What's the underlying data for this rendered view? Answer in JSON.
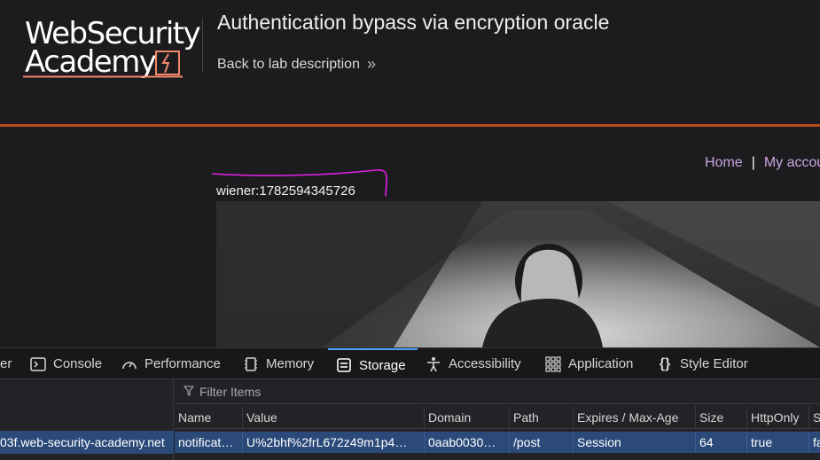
{
  "header": {
    "logo_line1": "WebSecurity",
    "logo_line2": "Academy",
    "lab_title": "Authentication bypass via encryption oracle",
    "back_link": "Back to lab description",
    "back_chevron": "»"
  },
  "nav": {
    "home": "Home",
    "separator": "|",
    "my_account": "My accou"
  },
  "content": {
    "user_identifier": "wiener:1782594345726"
  },
  "devtools": {
    "tabs": [
      {
        "label": "er",
        "icon": "inspector-icon"
      },
      {
        "label": "Console",
        "icon": "console-icon"
      },
      {
        "label": "Performance",
        "icon": "performance-icon"
      },
      {
        "label": "Memory",
        "icon": "memory-icon"
      },
      {
        "label": "Storage",
        "icon": "storage-icon",
        "active": true
      },
      {
        "label": "Accessibility",
        "icon": "accessibility-icon"
      },
      {
        "label": "Application",
        "icon": "application-icon"
      },
      {
        "label": "Style Editor",
        "icon": "style-editor-icon"
      }
    ],
    "tree_selected": "03f.web-security-academy.net",
    "filter_placeholder": "Filter Items",
    "columns": [
      "Name",
      "Value",
      "Domain",
      "Path",
      "Expires / Max-Age",
      "Size",
      "HttpOnly",
      "S"
    ],
    "rows": [
      [
        "notificat…",
        "U%2bhf%2frL672z49m1p4…",
        "0aab0030…",
        "/post",
        "Session",
        "64",
        "true",
        "fa"
      ]
    ]
  },
  "colors": {
    "accent": "#b84a1c",
    "nav_link": "#c9a4e0",
    "selection": "#2b4a7a",
    "annotation": "#e020e0"
  }
}
